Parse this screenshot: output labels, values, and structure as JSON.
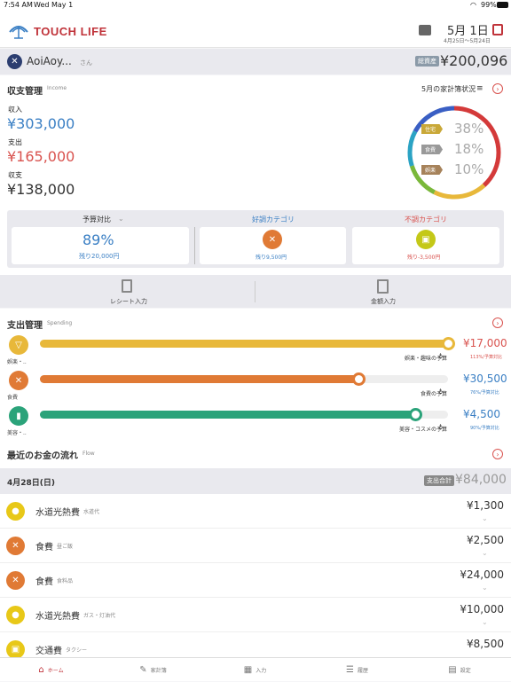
{
  "status": {
    "time": "7:54 AM",
    "date": "Wed May 1",
    "battery": "99%"
  },
  "header": {
    "logo": "TOUCH LIFE",
    "date_month": "5月",
    "date_day": "1日",
    "date_range": "4月25日～5月24日"
  },
  "user": {
    "name": "AoiAoy...",
    "suffix": "さん",
    "balance_label": "総資産",
    "balance": "¥200,096"
  },
  "income": {
    "title": "収支管理",
    "subtitle": "Income",
    "status_link": "5月の家計簿状況",
    "income_label": "収入",
    "income_value": "¥303,000",
    "expense_label": "支出",
    "expense_value": "¥165,000",
    "balance_label": "収支",
    "balance_value": "¥138,000"
  },
  "donut": {
    "items": [
      {
        "tag": "住宅",
        "pct": "38%",
        "color": "#c9a838"
      },
      {
        "tag": "食費",
        "pct": "18%",
        "color": "#999999"
      },
      {
        "tag": "娯楽",
        "pct": "10%",
        "color": "#a6825a"
      }
    ]
  },
  "budget": {
    "tab1": "予算対比",
    "tab2": "好調カテゴリ",
    "tab3": "不調カテゴリ",
    "pct": "89%",
    "remain1": "残り20,000円",
    "remain2": "残り9,500円",
    "remain3": "残り-3,500円"
  },
  "actions": {
    "receipt": "レシート入力",
    "amount": "金額入力"
  },
  "spending": {
    "title": "支出管理",
    "subtitle": "Spending",
    "items": [
      {
        "label": "娯楽・..",
        "fill": 1.0,
        "color": "#e8b83a",
        "amount": "¥17,000",
        "amount_color": "#d9534f",
        "budget_label": "娯楽・趣味の予算",
        "ratio": "113%/予算対比"
      },
      {
        "label": "食費",
        "fill": 0.78,
        "color": "#e07a35",
        "amount": "¥30,500",
        "amount_color": "#3a7fc4",
        "budget_label": "食費の予算",
        "ratio": "76%/予算対比"
      },
      {
        "label": "美容・..",
        "fill": 0.92,
        "color": "#2ba37a",
        "amount": "¥4,500",
        "amount_color": "#3a7fc4",
        "budget_label": "美容・コスメの予算",
        "ratio": "90%/予算対比"
      }
    ]
  },
  "flow": {
    "title": "最近のお金の流れ",
    "subtitle": "Flow",
    "date": "4月28日(日)",
    "total_label": "支出合計",
    "total": "¥84,000",
    "rows": [
      {
        "cat": "水道光熱費",
        "sub": "水道代",
        "amount": "¥1,300",
        "color": "#e8c818",
        "icon": "water-drop-icon"
      },
      {
        "cat": "食費",
        "sub": "昼ご飯",
        "amount": "¥2,500",
        "color": "#e07a35",
        "icon": "fork-knife-icon"
      },
      {
        "cat": "食費",
        "sub": "食料品",
        "amount": "¥24,000",
        "color": "#e07a35",
        "icon": "fork-knife-icon"
      },
      {
        "cat": "水道光熱費",
        "sub": "ガス・灯油代",
        "amount": "¥10,000",
        "color": "#e8c818",
        "icon": "water-drop-icon"
      },
      {
        "cat": "交通費",
        "sub": "タクシー",
        "amount": "¥8,500",
        "color": "#e8c818",
        "icon": "train-icon"
      }
    ]
  },
  "tabs": [
    "ホーム",
    "家計簿",
    "入力",
    "履歴",
    "設定"
  ]
}
